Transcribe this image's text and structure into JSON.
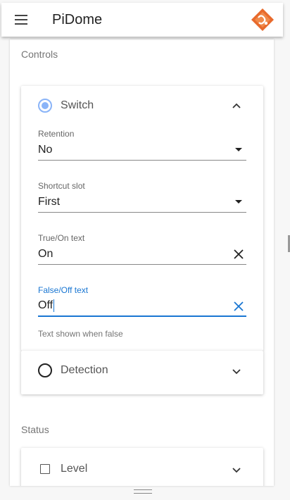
{
  "app": {
    "title": "PiDome"
  },
  "sections": {
    "controls": "Controls",
    "status": "Status"
  },
  "switch_card": {
    "title": "Switch",
    "retention": {
      "label": "Retention",
      "value": "No"
    },
    "shortcut_slot": {
      "label": "Shortcut slot",
      "value": "First"
    },
    "true_text": {
      "label": "True/On text",
      "value": "On"
    },
    "false_text": {
      "label": "False/Off text",
      "value": "Off",
      "helper": "Text shown when false"
    }
  },
  "detection_card": {
    "title": "Detection"
  },
  "level_card": {
    "title": "Level"
  },
  "colors": {
    "accent": "#1976d2",
    "radio_selected": "#8ab4f8",
    "logo": "#e86a2c"
  }
}
